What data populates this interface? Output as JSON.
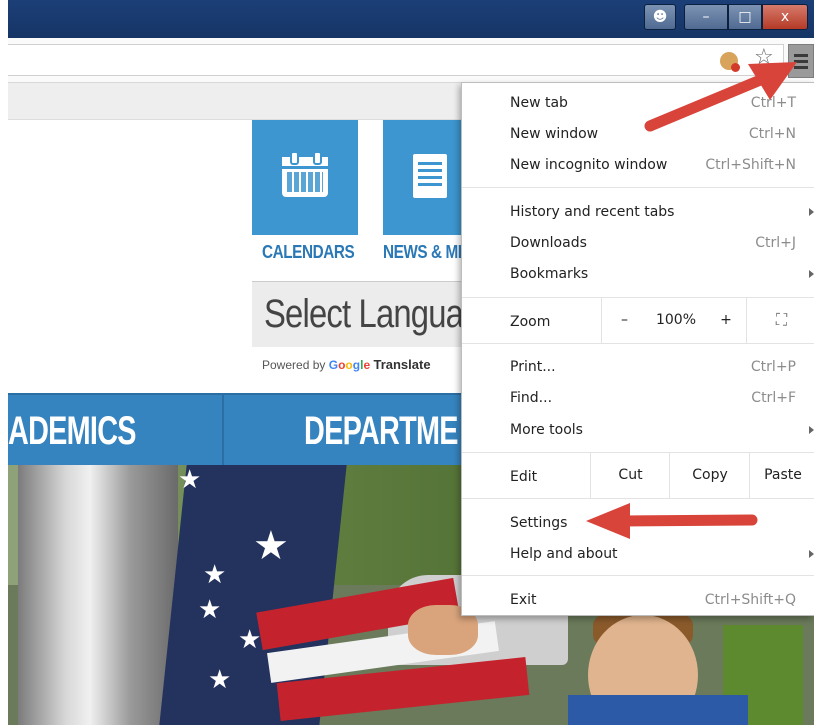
{
  "window": {
    "user_icon": "user-icon",
    "minimize_label": "–",
    "maximize_label": "□",
    "close_label": "x"
  },
  "toolbar": {
    "extension_icon": "cookie-extension-icon",
    "bookmark_icon": "star-icon",
    "menu_icon": "hamburger-menu-icon"
  },
  "page": {
    "tiles": [
      {
        "label": "CALENDARS",
        "icon": "calendar-icon"
      },
      {
        "label": "NEWS & MI",
        "icon": "news-icon"
      }
    ],
    "select_language": "Select Langua",
    "powered_by": "Powered by",
    "google": [
      "G",
      "o",
      "o",
      "g",
      "l",
      "e"
    ],
    "translate": "Translate",
    "nav": [
      "ADEMICS",
      "DEPARTME"
    ]
  },
  "menu": {
    "group1": [
      {
        "label": "New tab",
        "shortcut": "Ctrl+T"
      },
      {
        "label": "New window",
        "shortcut": "Ctrl+N"
      },
      {
        "label": "New incognito window",
        "shortcut": "Ctrl+Shift+N"
      }
    ],
    "group2": [
      {
        "label": "History and recent tabs",
        "shortcut": ""
      },
      {
        "label": "Downloads",
        "shortcut": "Ctrl+J"
      },
      {
        "label": "Bookmarks",
        "shortcut": ""
      }
    ],
    "zoom": {
      "label": "Zoom",
      "minus": "–",
      "value": "100%",
      "plus": "+",
      "fullscreen_icon": "fullscreen-icon"
    },
    "group3": [
      {
        "label": "Print...",
        "shortcut": "Ctrl+P"
      },
      {
        "label": "Find...",
        "shortcut": "Ctrl+F"
      },
      {
        "label": "More tools",
        "shortcut": ""
      }
    ],
    "edit": {
      "label": "Edit",
      "cut": "Cut",
      "copy": "Copy",
      "paste": "Paste"
    },
    "group4": [
      {
        "label": "Settings"
      },
      {
        "label": "Help and about"
      }
    ],
    "exit": {
      "label": "Exit",
      "shortcut": "Ctrl+Shift+Q"
    }
  },
  "annotations": {
    "arrow_color": "#d9443a"
  }
}
